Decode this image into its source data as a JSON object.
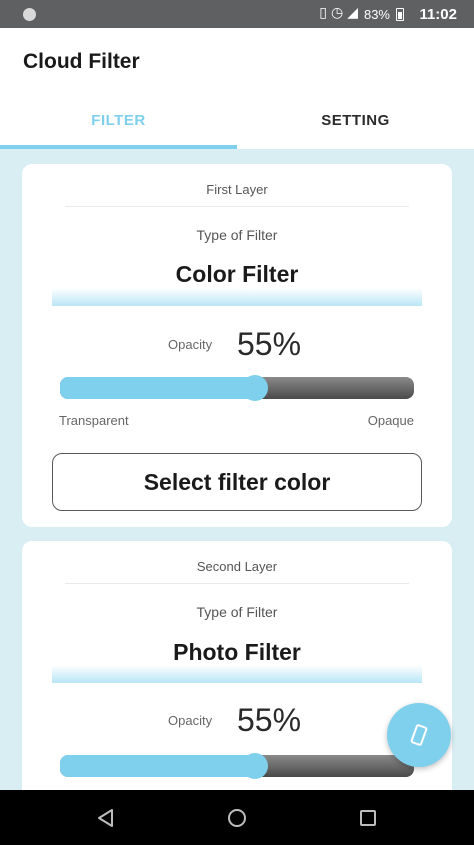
{
  "status_bar": {
    "battery_percent": "83%",
    "time": "11:02",
    "icons": [
      "app-notification-icon",
      "vibrate-icon",
      "alarm-icon",
      "signal-icon",
      "battery-icon"
    ]
  },
  "app": {
    "title": "Cloud Filter"
  },
  "tabs": [
    {
      "label": "FILTER",
      "active": true
    },
    {
      "label": "SETTING",
      "active": false
    }
  ],
  "accent_color": "#7fd0ec",
  "layers": [
    {
      "title": "First Layer",
      "type_label": "Type of Filter",
      "filter_name": "Color Filter",
      "opacity_label": "Opacity",
      "opacity_value": "55%",
      "opacity_fraction": 0.55,
      "min_label": "Transparent",
      "max_label": "Opaque",
      "button_label": "Select filter color"
    },
    {
      "title": "Second Layer",
      "type_label": "Type of Filter",
      "filter_name": "Photo Filter",
      "opacity_label": "Opacity",
      "opacity_value": "55%",
      "opacity_fraction": 0.55
    }
  ],
  "fab": {
    "icon": "rotate-device-icon"
  },
  "nav_bar": {
    "buttons": [
      "back-icon",
      "home-icon",
      "recent-apps-icon"
    ]
  }
}
